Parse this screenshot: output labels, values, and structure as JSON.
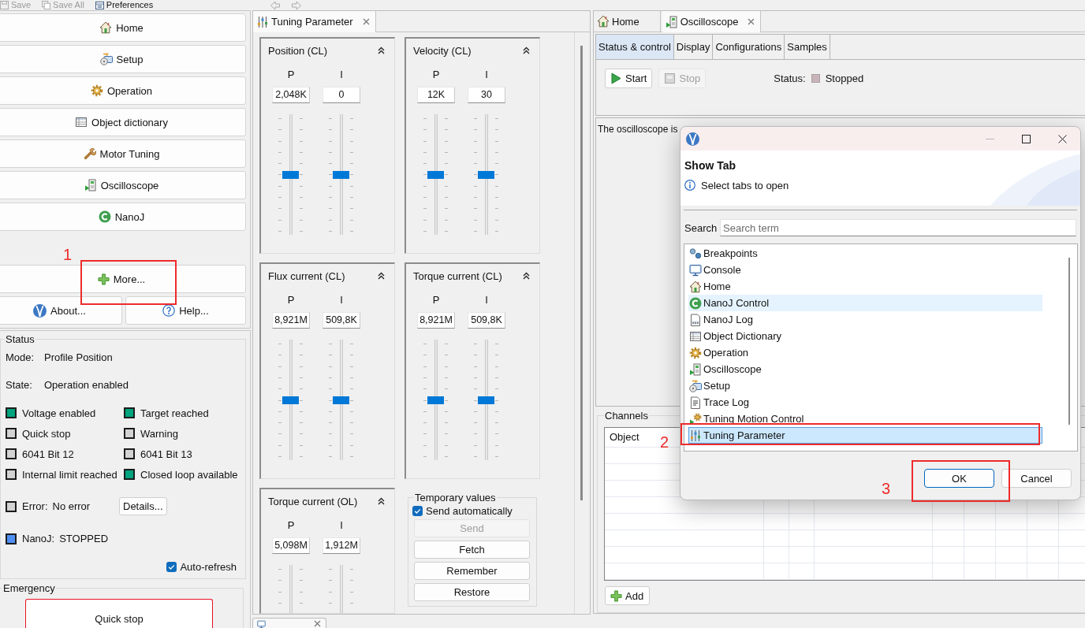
{
  "toolbar": {
    "items": [
      {
        "label": "Save",
        "kind": "save",
        "disabled": true
      },
      {
        "label": "Save All",
        "kind": "save-all",
        "disabled": true
      },
      {
        "label": "Preferences",
        "kind": "preferences",
        "disabled": false
      }
    ]
  },
  "navigation": {
    "items": [
      {
        "label": "Home",
        "kind": "home"
      },
      {
        "label": "Setup",
        "kind": "setup"
      },
      {
        "label": "Operation",
        "kind": "operation"
      },
      {
        "label": "Object dictionary",
        "kind": "object-dictionary"
      },
      {
        "label": "Motor Tuning",
        "kind": "motor-tuning"
      },
      {
        "label": "Oscilloscope",
        "kind": "oscilloscope"
      },
      {
        "label": "NanoJ",
        "kind": "nanoj"
      }
    ],
    "more": {
      "label": "More...",
      "callout": "1"
    },
    "about": {
      "label": "About..."
    },
    "help": {
      "label": "Help..."
    }
  },
  "status": {
    "title": "Status",
    "mode": {
      "label": "Mode:",
      "value": "Profile Position"
    },
    "state": {
      "label": "State:",
      "value": "Operation enabled"
    },
    "indicators": [
      {
        "label": "Voltage enabled",
        "color": "#00a47e"
      },
      {
        "label": "Target reached",
        "color": "#00a47e"
      },
      {
        "label": "Quick stop",
        "color": "#d3d3d3"
      },
      {
        "label": "Warning",
        "color": "#d3d3d3"
      },
      {
        "label": "6041 Bit 12",
        "color": "#d3d3d3"
      },
      {
        "label": "6041 Bit 13",
        "color": "#d3d3d3"
      },
      {
        "label": "Internal limit reached",
        "color": "#d3d3d3"
      },
      {
        "label": "Closed loop available",
        "color": "#00a47e"
      }
    ],
    "signals": [
      {
        "label": "Error:",
        "value": "No error",
        "color": "#d3d3d3",
        "button": "Details..."
      },
      {
        "label": "NanoJ:",
        "value": "STOPPED",
        "color": "#4d8ff5"
      }
    ],
    "auto_refresh": {
      "label": "Auto-refresh",
      "checked": true
    }
  },
  "emergency": {
    "title": "Emergency",
    "button": "Quick stop"
  },
  "tuning_view": {
    "tabs": [
      {
        "label": "Tuning Parameter",
        "kind": "tuning-parameter",
        "selected": true,
        "closable": true
      }
    ],
    "panels": [
      {
        "title": "Position (CL)",
        "controls": [
          {
            "label": "P",
            "value": "2,048K",
            "level": 0.5
          },
          {
            "label": "I",
            "value": "0",
            "level": 0.5
          }
        ]
      },
      {
        "title": "Velocity (CL)",
        "controls": [
          {
            "label": "P",
            "value": "12K",
            "level": 0.5
          },
          {
            "label": "I",
            "value": "30",
            "level": 0.5
          }
        ]
      },
      {
        "title": "Flux current (CL)",
        "controls": [
          {
            "label": "P",
            "value": "8,921M",
            "level": 0.5
          },
          {
            "label": "I",
            "value": "509,8K",
            "level": 0.5
          }
        ]
      },
      {
        "title": "Torque current (CL)",
        "controls": [
          {
            "label": "P",
            "value": "8,921M",
            "level": 0.5
          },
          {
            "label": "I",
            "value": "509,8K",
            "level": 0.5
          }
        ]
      },
      {
        "title": "Torque current (OL)",
        "controls": [
          {
            "label": "P",
            "value": "5,098M"
          },
          {
            "label": "I",
            "value": "1,912M"
          }
        ]
      }
    ],
    "temporary_values": {
      "title": "Temporary values",
      "send_automatically": {
        "label": "Send automatically",
        "checked": true
      },
      "buttons": [
        {
          "label": "Send",
          "disabled": true
        },
        {
          "label": "Fetch",
          "disabled": false
        },
        {
          "label": "Remember",
          "disabled": false
        },
        {
          "label": "Restore",
          "disabled": false
        }
      ]
    },
    "bottom_tabs": [
      {
        "kind": "console",
        "closable": true
      }
    ]
  },
  "editor": {
    "tabs": [
      {
        "label": "Home",
        "kind": "home",
        "selected": false,
        "closable": false
      },
      {
        "label": "Oscilloscope",
        "kind": "oscilloscope",
        "selected": true,
        "closable": true
      }
    ],
    "subtabs": [
      {
        "label": "Status & control",
        "selected": true
      },
      {
        "label": "Display",
        "selected": false
      },
      {
        "label": "Configurations",
        "selected": false
      },
      {
        "label": "Samples",
        "selected": false
      }
    ],
    "actions": [
      {
        "label": "Start",
        "kind": "start",
        "disabled": false
      },
      {
        "label": "Stop",
        "kind": "stop",
        "disabled": true
      }
    ],
    "status": {
      "label": "Status:",
      "value": "Stopped"
    },
    "message": "The oscilloscope is",
    "channels": {
      "title": "Channels",
      "columns": [
        "Object"
      ]
    },
    "add_button": {
      "label": "Add"
    }
  },
  "dialog": {
    "heading": "Show Tab",
    "hint": "Select tabs to open",
    "search": {
      "label": "Search",
      "placeholder": "Search term"
    },
    "items": [
      {
        "label": "Breakpoints",
        "kind": "breakpoints",
        "selected": false,
        "hovered": false
      },
      {
        "label": "Console",
        "kind": "console",
        "selected": false,
        "hovered": false
      },
      {
        "label": "Home",
        "kind": "home",
        "selected": false,
        "hovered": false
      },
      {
        "label": "NanoJ Control",
        "kind": "nanoj",
        "selected": false,
        "hovered": true
      },
      {
        "label": "NanoJ Log",
        "kind": "nanoj-log",
        "selected": false,
        "hovered": false
      },
      {
        "label": "Object Dictionary",
        "kind": "object-dictionary",
        "selected": false,
        "hovered": false
      },
      {
        "label": "Operation",
        "kind": "operation",
        "selected": false,
        "hovered": false
      },
      {
        "label": "Oscilloscope",
        "kind": "oscilloscope",
        "selected": false,
        "hovered": false
      },
      {
        "label": "Setup",
        "kind": "setup",
        "selected": false,
        "hovered": false
      },
      {
        "label": "Trace Log",
        "kind": "trace-log",
        "selected": false,
        "hovered": false
      },
      {
        "label": "Tuning Motion Control",
        "kind": "tuning-motion-control",
        "selected": false,
        "hovered": false
      },
      {
        "label": "Tuning Parameter",
        "kind": "tuning-parameter",
        "selected": true,
        "hovered": false,
        "callout": "2"
      }
    ],
    "buttons": [
      {
        "label": "OK",
        "default": true,
        "callout": "3"
      },
      {
        "label": "Cancel",
        "default": false
      }
    ]
  }
}
